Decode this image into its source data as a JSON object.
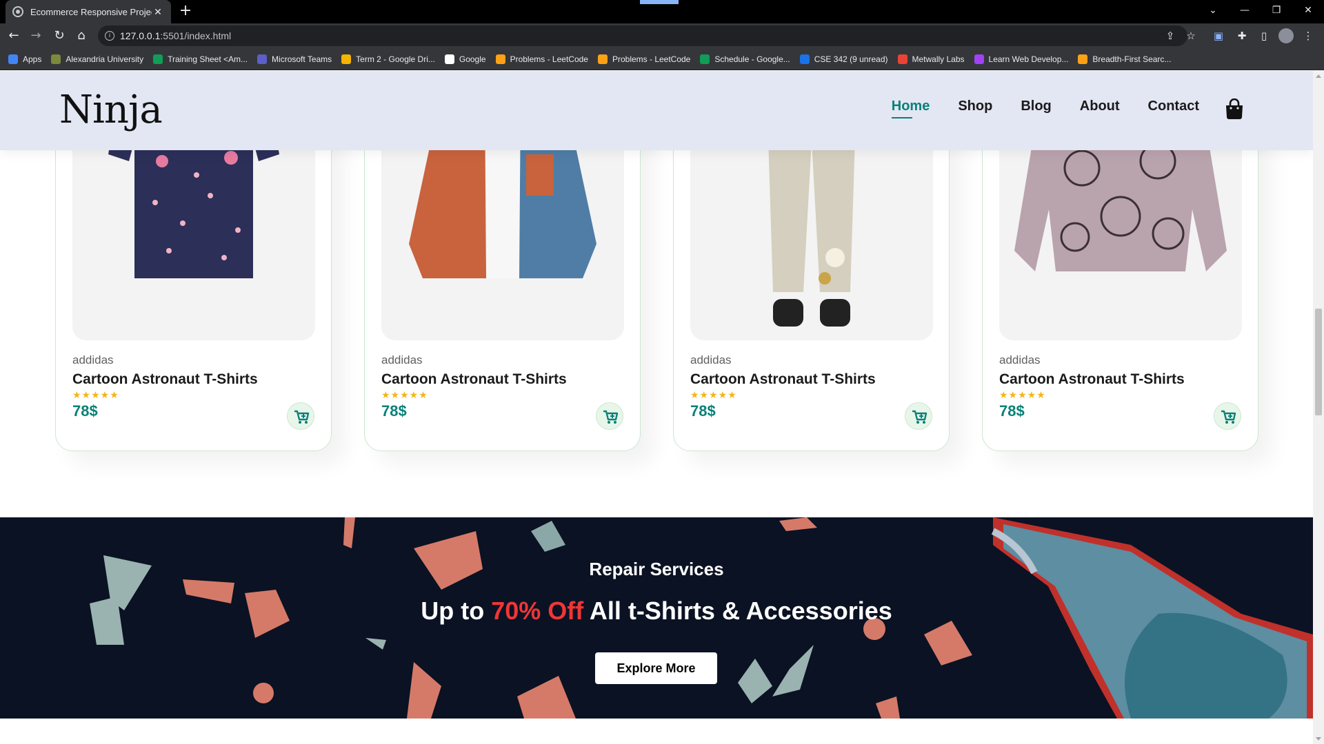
{
  "browser": {
    "tab_title": "Ecommerce Responsive Project",
    "tab_close": "✕",
    "new_tab": "+",
    "url_host": "127.0.0.1",
    "url_rest": ":5501/index.html",
    "bookmarks": [
      {
        "label": "Apps",
        "color": "#4285f4"
      },
      {
        "label": "Alexandria University",
        "color": "#7a8a3a"
      },
      {
        "label": "Training Sheet <Am...",
        "color": "#0f9d58"
      },
      {
        "label": "Microsoft Teams",
        "color": "#5b5fc7"
      },
      {
        "label": "Term 2 - Google Dri...",
        "color": "#f4b400"
      },
      {
        "label": "Google",
        "color": "#ffffff"
      },
      {
        "label": "Problems - LeetCode",
        "color": "#ffa116"
      },
      {
        "label": "Problems - LeetCode",
        "color": "#ffa116"
      },
      {
        "label": "Schedule - Google...",
        "color": "#0f9d58"
      },
      {
        "label": "CSE 342 (9 unread)",
        "color": "#1a73e8"
      },
      {
        "label": "Metwally Labs",
        "color": "#ea4335"
      },
      {
        "label": "Learn Web Develop...",
        "color": "#a142f4"
      },
      {
        "label": "Breadth-First Searc...",
        "color": "#ffa116"
      }
    ]
  },
  "header": {
    "logo": "Ninja",
    "nav": [
      "Home",
      "Shop",
      "Blog",
      "About",
      "Contact"
    ],
    "active": "Home"
  },
  "products": [
    {
      "brand": "addidas",
      "name": "Cartoon Astronaut T-Shirts",
      "stars": "★★★★★",
      "rating": 5,
      "price": "78$",
      "image": "floral-shirt"
    },
    {
      "brand": "addidas",
      "name": "Cartoon Astronaut T-Shirts",
      "stars": "★★★★★",
      "rating": 5,
      "price": "78$",
      "image": "corduroy-jacket"
    },
    {
      "brand": "addidas",
      "name": "Cartoon Astronaut T-Shirts",
      "stars": "★★★★★",
      "rating": 5,
      "price": "78$",
      "image": "linen-pants"
    },
    {
      "brand": "addidas",
      "name": "Cartoon Astronaut T-Shirts",
      "stars": "★★★★★",
      "rating": 5,
      "price": "78$",
      "image": "cat-print-top"
    }
  ],
  "banner": {
    "subtitle": "Repair Services",
    "title_pre": "Up to ",
    "title_highlight": "70% Off",
    "title_post": " All t-Shirts & Accessories",
    "button": "Explore More"
  },
  "colors": {
    "accent": "#088178",
    "header_bg": "#e3e6f3",
    "banner_bg": "#0b1223",
    "highlight": "#ef3636",
    "star": "#f3b519"
  }
}
